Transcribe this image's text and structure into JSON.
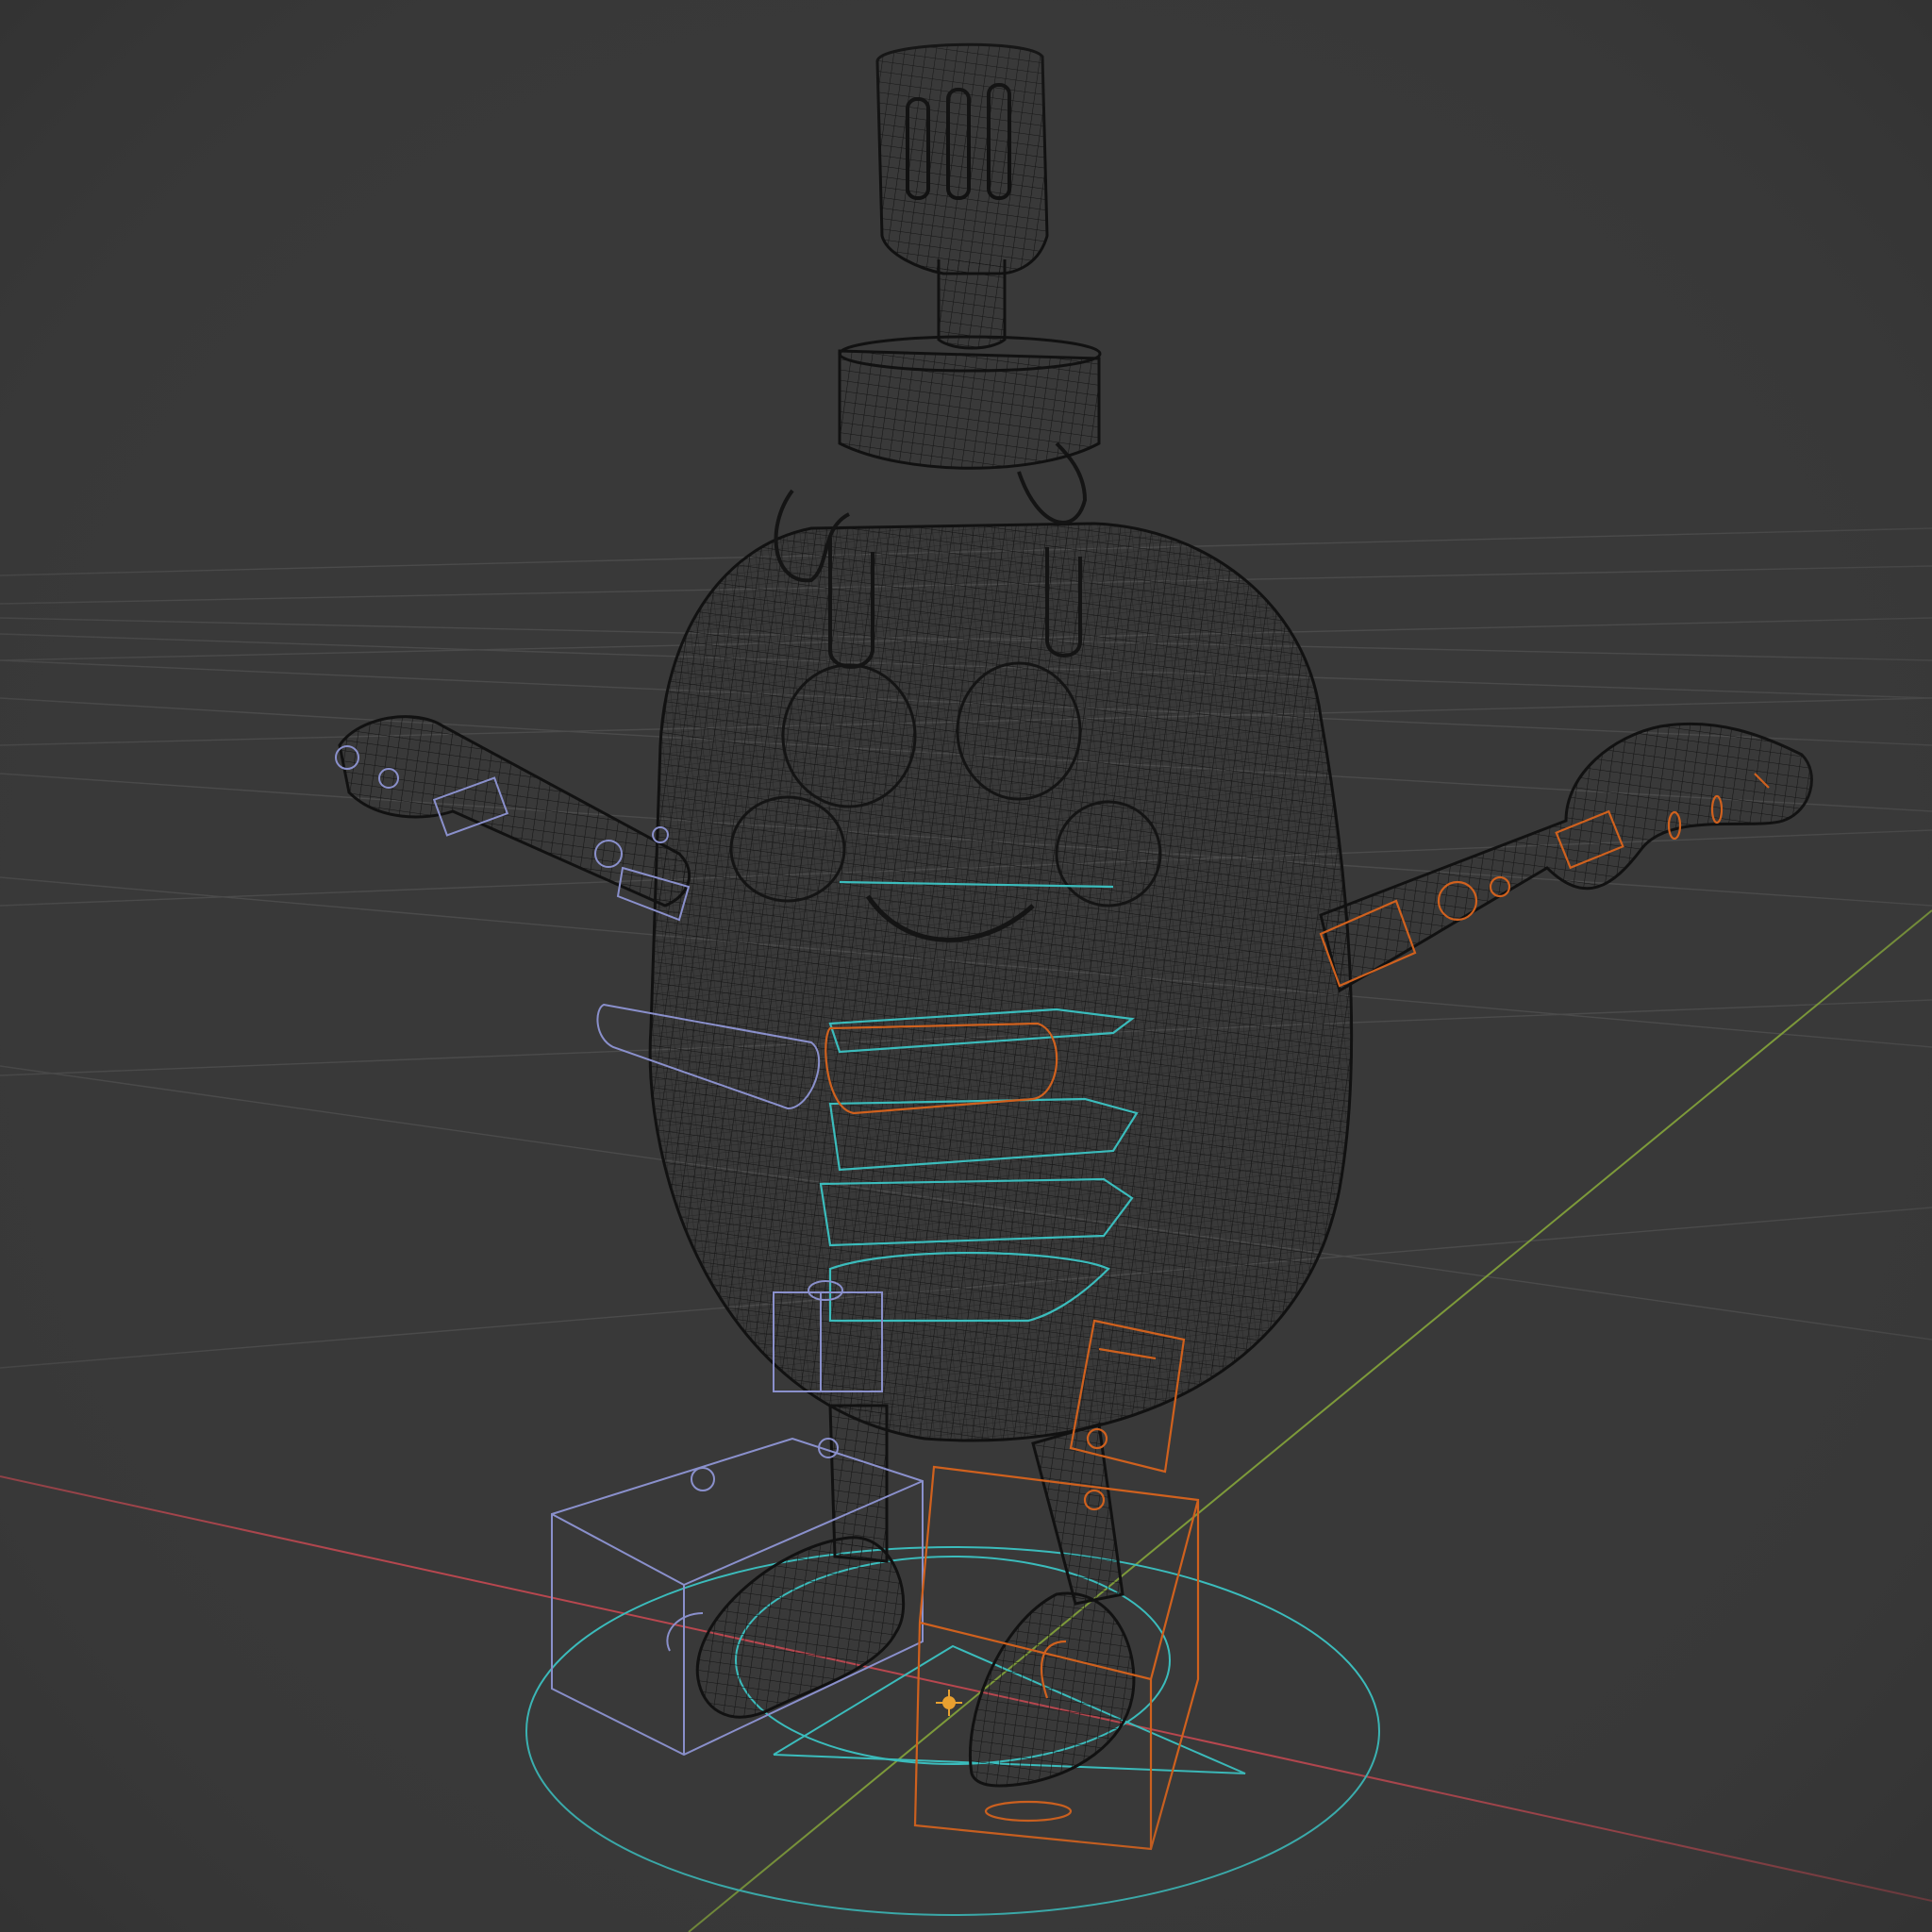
{
  "viewport": {
    "mode": "wireframe",
    "colors": {
      "background": "#393939",
      "grid_line": "#4a4a4a",
      "axis_x": "#b8474f",
      "axis_y": "#7d9a3a",
      "mesh_wire": "#151515",
      "control_left": "#8a90cc",
      "control_right": "#d0611e",
      "control_center": "#3bbcbc",
      "origin_marker": "#e8a030"
    },
    "icons": [
      "grid-floor",
      "x-axis-line",
      "y-axis-line",
      "character-wireframe-mesh",
      "rig-controls",
      "3d-cursor-icon"
    ]
  }
}
